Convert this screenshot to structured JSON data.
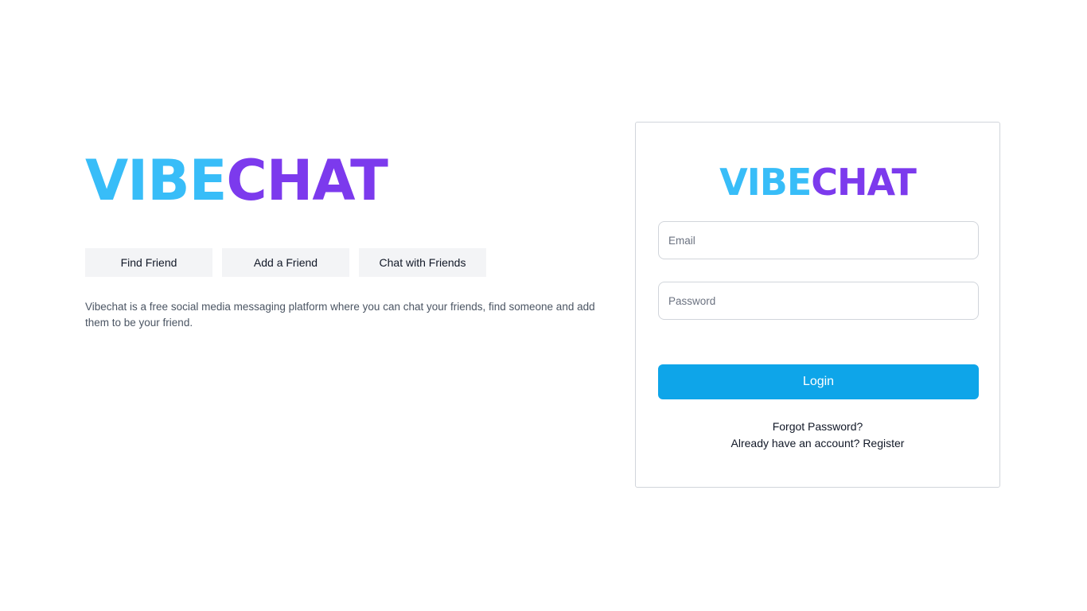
{
  "brand": {
    "part_a": "VIBE",
    "part_b": "CHAT",
    "color_a": "#38bdf8",
    "color_b": "#7c3aed"
  },
  "hero": {
    "features": [
      {
        "label": "Find Friend"
      },
      {
        "label": "Add a Friend"
      },
      {
        "label": "Chat with Friends"
      }
    ],
    "description": "Vibechat is a free social media messaging platform where you can chat your friends, find someone and add them to be your friend."
  },
  "login": {
    "email_placeholder": "Email",
    "email_value": "",
    "password_placeholder": "Password",
    "password_value": "",
    "submit_label": "Login",
    "accent_color": "#0ea5e9",
    "forgot_label": "Forgot Password?",
    "register_prompt": "Already have an account?",
    "register_label": "Register"
  }
}
